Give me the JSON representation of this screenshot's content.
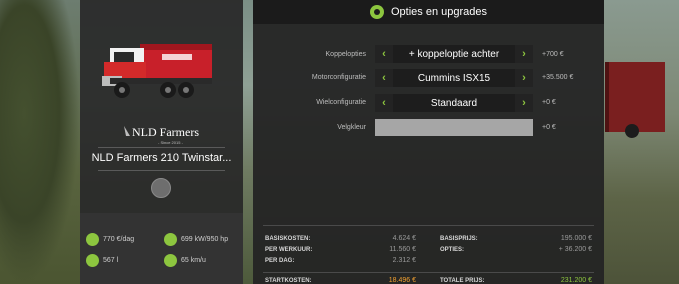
{
  "header": {
    "title": "Opties en upgrades"
  },
  "vehicle": {
    "brand": "NLD Farmers",
    "brand_since": "Since 2015",
    "name": "NLD Farmers 210 Twinstar...",
    "stats": [
      {
        "icon": "dollar-icon",
        "value": "770 €/dag"
      },
      {
        "icon": "engine-power-icon",
        "value": "699 kW/950 hp"
      },
      {
        "icon": "fuel-icon",
        "value": "567 l"
      },
      {
        "icon": "speedometer-icon",
        "value": "65 km/u"
      }
    ]
  },
  "options": [
    {
      "label": "Koppelopties",
      "value": "+ koppeloptie achter",
      "price": "+700 €"
    },
    {
      "label": "Motorconfiguratie",
      "value": "Cummins ISX15",
      "price": "+35.500 €"
    },
    {
      "label": "Wielconfiguratie",
      "value": "Standaard",
      "price": "+0 €"
    }
  ],
  "color_option": {
    "label": "Velgkleur",
    "price": "+0 €",
    "swatch": "#a6a6a6"
  },
  "summary": {
    "left": [
      {
        "label": "BASISKOSTEN:",
        "value": "4.624 €"
      },
      {
        "label": "PER WERKUUR:",
        "value": "11.560 €"
      },
      {
        "label": "PER DAG:",
        "value": "2.312 €"
      }
    ],
    "right": [
      {
        "label": "BASISPRIJS:",
        "value": "195.000 €"
      },
      {
        "label": "OPTIES:",
        "value": "+ 36.200 €"
      }
    ],
    "start_label": "STARTKOSTEN:",
    "start_value": "18.496 €",
    "total_label": "TOTALE PRIJS:",
    "total_value": "231.200 €"
  },
  "colors": {
    "accent": "#8dc63f",
    "start_cost": "#f0a030",
    "panel": "#262626"
  }
}
